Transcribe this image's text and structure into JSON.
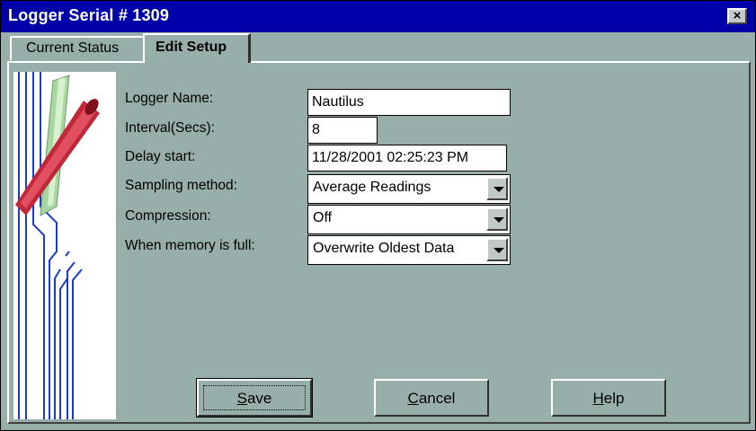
{
  "window": {
    "title": "Logger Serial # 1309",
    "close_glyph": "×"
  },
  "tabs": [
    {
      "label": "Current Status",
      "active": false
    },
    {
      "label": "Edit Setup",
      "active": true
    }
  ],
  "form": {
    "logger_name": {
      "label": "Logger Name:",
      "value": "Nautilus"
    },
    "interval": {
      "label": "Interval(Secs):",
      "value": "8"
    },
    "delay_start": {
      "label": "Delay start:",
      "value": "11/28/2001 02:25:23 PM"
    },
    "sampling_method": {
      "label": "Sampling method:",
      "value": "Average Readings"
    },
    "compression": {
      "label": "Compression:",
      "value": "Off"
    },
    "memory_full": {
      "label": "When memory is full:",
      "value": "Overwrite Oldest Data"
    }
  },
  "buttons": {
    "save": {
      "first": "S",
      "rest": "ave"
    },
    "cancel": {
      "first": "C",
      "rest": "ancel"
    },
    "help": {
      "first": "H",
      "rest": "elp"
    }
  },
  "colors": {
    "window_bg": "#98aeaa",
    "titlebar": "#0000a8",
    "logger_red": "#c0283a",
    "circuit_blue": "#1a3cc8"
  }
}
